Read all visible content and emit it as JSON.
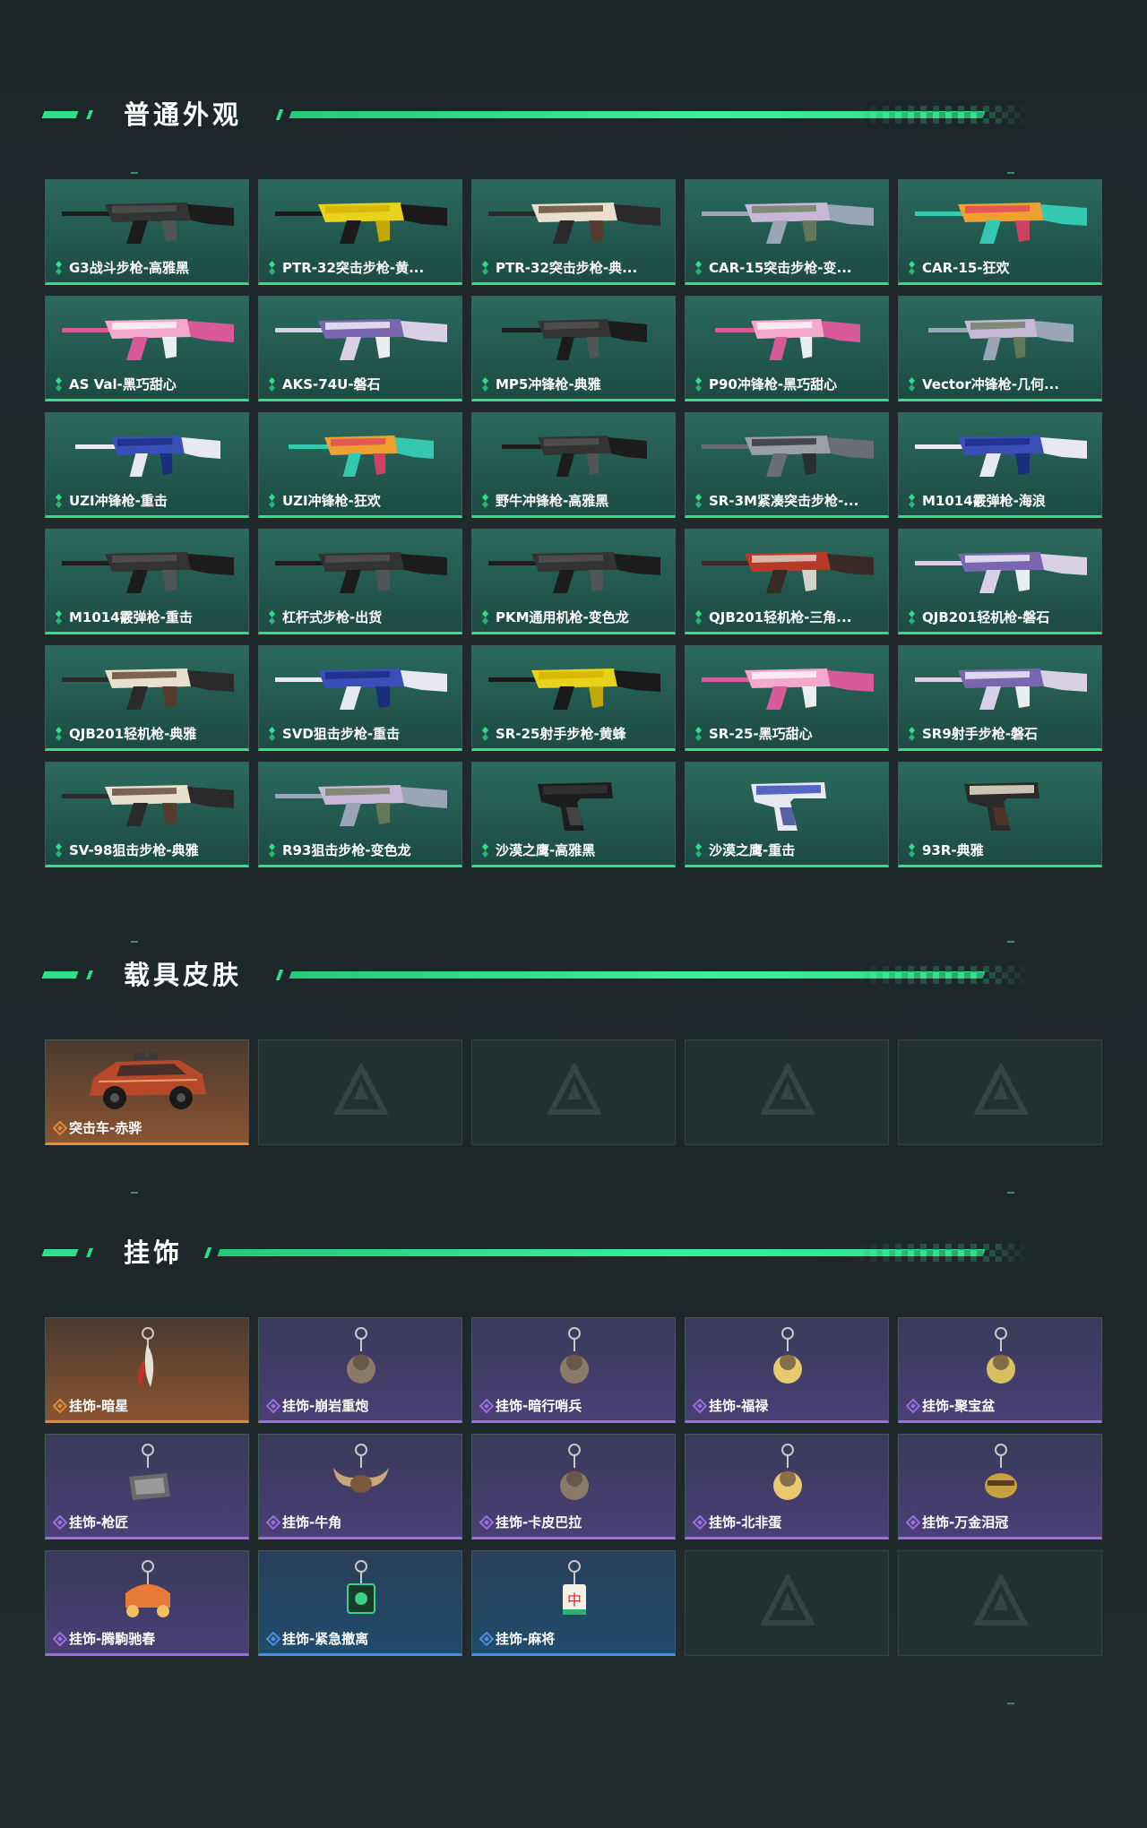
{
  "sections": {
    "normal": {
      "title": "普通外观",
      "items": [
        {
          "label": "G3战斗步枪-高雅黑",
          "rarity": "green",
          "icon": "rifle-black-icon"
        },
        {
          "label": "PTR-32突击步枪-黄...",
          "rarity": "green",
          "icon": "rifle-yellow-icon"
        },
        {
          "label": "PTR-32突击步枪-典...",
          "rarity": "green",
          "icon": "rifle-wood-icon"
        },
        {
          "label": "CAR-15突击步枪-变...",
          "rarity": "green",
          "icon": "rifle-camo-icon"
        },
        {
          "label": "CAR-15-狂欢",
          "rarity": "green",
          "icon": "rifle-carnival-icon"
        },
        {
          "label": "AS Val-黑巧甜心",
          "rarity": "green",
          "icon": "rifle-pink-icon"
        },
        {
          "label": "AKS-74U-磐石",
          "rarity": "green",
          "icon": "rifle-purple-camo-icon"
        },
        {
          "label": "MP5冲锋枪-典雅",
          "rarity": "green",
          "icon": "smg-icon"
        },
        {
          "label": "P90冲锋枪-黑巧甜心",
          "rarity": "green",
          "icon": "smg-pink-icon"
        },
        {
          "label": "Vector冲锋枪-几何...",
          "rarity": "green",
          "icon": "smg-geo-icon"
        },
        {
          "label": "UZI冲锋枪-重击",
          "rarity": "green",
          "icon": "smg-blue-icon"
        },
        {
          "label": "UZI冲锋枪-狂欢",
          "rarity": "green",
          "icon": "smg-carnival-icon"
        },
        {
          "label": "野牛冲锋枪-高雅黑",
          "rarity": "green",
          "icon": "smg-black-icon"
        },
        {
          "label": "SR-3M紧凑突击步枪-...",
          "rarity": "green",
          "icon": "rifle-gray-icon"
        },
        {
          "label": "M1014霰弹枪-海浪",
          "rarity": "green",
          "icon": "shotgun-blue-icon"
        },
        {
          "label": "M1014霰弹枪-重击",
          "rarity": "green",
          "icon": "shotgun-white-icon"
        },
        {
          "label": "杠杆式步枪-出货",
          "rarity": "green",
          "icon": "lever-rifle-icon"
        },
        {
          "label": "PKM通用机枪-变色龙",
          "rarity": "green",
          "icon": "machinegun-icon"
        },
        {
          "label": "QJB201轻机枪-三角...",
          "rarity": "green",
          "icon": "lmg-red-icon"
        },
        {
          "label": "QJB201轻机枪-磐石",
          "rarity": "green",
          "icon": "lmg-purple-icon"
        },
        {
          "label": "QJB201轻机枪-典雅",
          "rarity": "green",
          "icon": "lmg-wood-icon"
        },
        {
          "label": "SVD狙击步枪-重击",
          "rarity": "green",
          "icon": "sniper-blue-icon"
        },
        {
          "label": "SR-25射手步枪-黄蜂",
          "rarity": "green",
          "icon": "marksman-yellow-icon"
        },
        {
          "label": "SR-25-黑巧甜心",
          "rarity": "green",
          "icon": "marksman-pink-icon"
        },
        {
          "label": "SR9射手步枪-磐石",
          "rarity": "green",
          "icon": "marksman-purple-icon"
        },
        {
          "label": "SV-98狙击步枪-典雅",
          "rarity": "green",
          "icon": "sniper-wood-icon"
        },
        {
          "label": "R93狙击步枪-变色龙",
          "rarity": "green",
          "icon": "sniper-camo-icon"
        },
        {
          "label": "沙漠之鹰-高雅黑",
          "rarity": "green",
          "icon": "pistol-black-icon"
        },
        {
          "label": "沙漠之鹰-重击",
          "rarity": "green",
          "icon": "pistol-blue-icon"
        },
        {
          "label": "93R-典雅",
          "rarity": "green",
          "icon": "pistol-wood-icon"
        }
      ]
    },
    "vehicle": {
      "title": "载具皮肤",
      "items": [
        {
          "label": "突击车-赤骅",
          "rarity": "orange",
          "icon": "vehicle-icon"
        }
      ],
      "empty_slots": 4
    },
    "charm": {
      "title": "挂饰",
      "items": [
        {
          "label": "挂饰-暗星",
          "rarity": "orange",
          "icon": "charm-feather-icon"
        },
        {
          "label": "挂饰-崩岩重炮",
          "rarity": "purple",
          "icon": "charm-figure-icon"
        },
        {
          "label": "挂饰-暗行哨兵",
          "rarity": "purple",
          "icon": "charm-sentinel-icon"
        },
        {
          "label": "挂饰-福禄",
          "rarity": "purple",
          "icon": "charm-gourd-icon"
        },
        {
          "label": "挂饰-聚宝盆",
          "rarity": "purple",
          "icon": "charm-bowl-icon"
        },
        {
          "label": "挂饰-枪匠",
          "rarity": "purple",
          "icon": "charm-box-icon"
        },
        {
          "label": "挂饰-牛角",
          "rarity": "purple",
          "icon": "charm-horns-icon"
        },
        {
          "label": "挂饰-卡皮巴拉",
          "rarity": "purple",
          "icon": "charm-capybara-icon"
        },
        {
          "label": "挂饰-北非蛋",
          "rarity": "purple",
          "icon": "charm-egg-icon"
        },
        {
          "label": "挂饰-万金泪冠",
          "rarity": "purple",
          "icon": "charm-crown-icon"
        },
        {
          "label": "挂饰-腾駒驰春",
          "rarity": "purple",
          "icon": "charm-carriage-icon"
        },
        {
          "label": "挂饰-紧急撤离",
          "rarity": "blue",
          "icon": "charm-exit-icon"
        },
        {
          "label": "挂饰-麻将",
          "rarity": "blue",
          "icon": "charm-mahjong-icon"
        }
      ],
      "empty_slots": 2,
      "mahjong_char": "中"
    }
  },
  "colors": {
    "accent": "#2ee08a",
    "green": "#2ee08a",
    "orange": "#e08a3a",
    "purple": "#9a70e0",
    "blue": "#4a90e0"
  }
}
